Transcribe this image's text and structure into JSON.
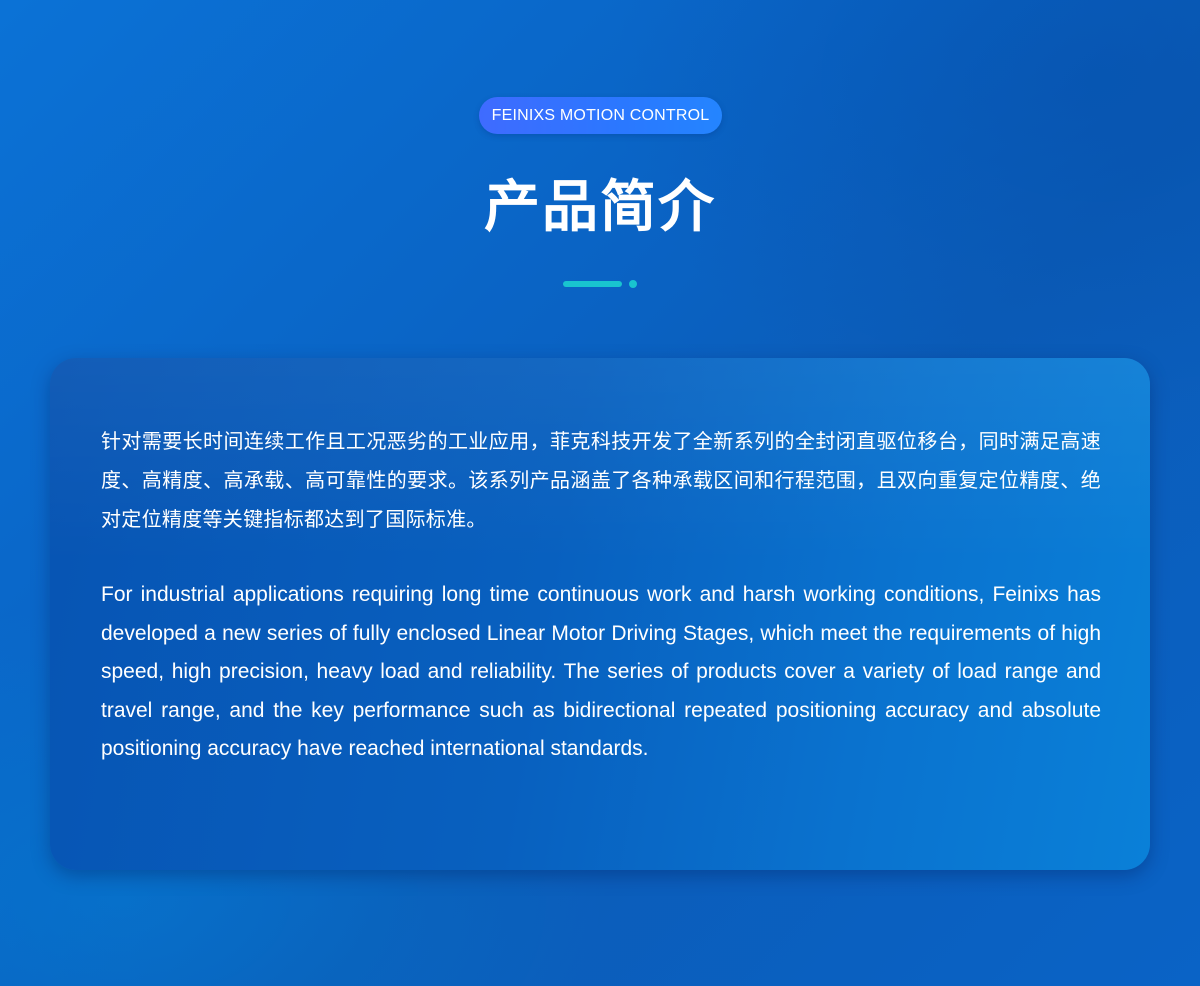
{
  "header": {
    "badge": "FEINIXS MOTION CONTROL",
    "title": "产品简介"
  },
  "colors": {
    "accent": "#19c4cf",
    "badge": "#3a6fff",
    "card": "#0860bf",
    "background": "#0b6acc"
  },
  "intro": {
    "chinese": "针对需要长时间连续工作且工况恶劣的工业应用，菲克科技开发了全新系列的全封闭直驱位移台，同时满足高速度、高精度、高承载、高可靠性的要求。该系列产品涵盖了各种承载区间和行程范围，且双向重复定位精度、绝对定位精度等关键指标都达到了国际标准。",
    "english": "For industrial applications requiring long time continuous work and harsh working conditions, Feinixs has developed a new series of fully enclosed Linear Motor Driving Stages, which meet the requirements of high speed, high precision, heavy load and reliability. The series of products cover a variety of load range and travel range, and the key performance such as bidirectional repeated positioning accuracy and absolute positioning accuracy have reached international standards."
  }
}
